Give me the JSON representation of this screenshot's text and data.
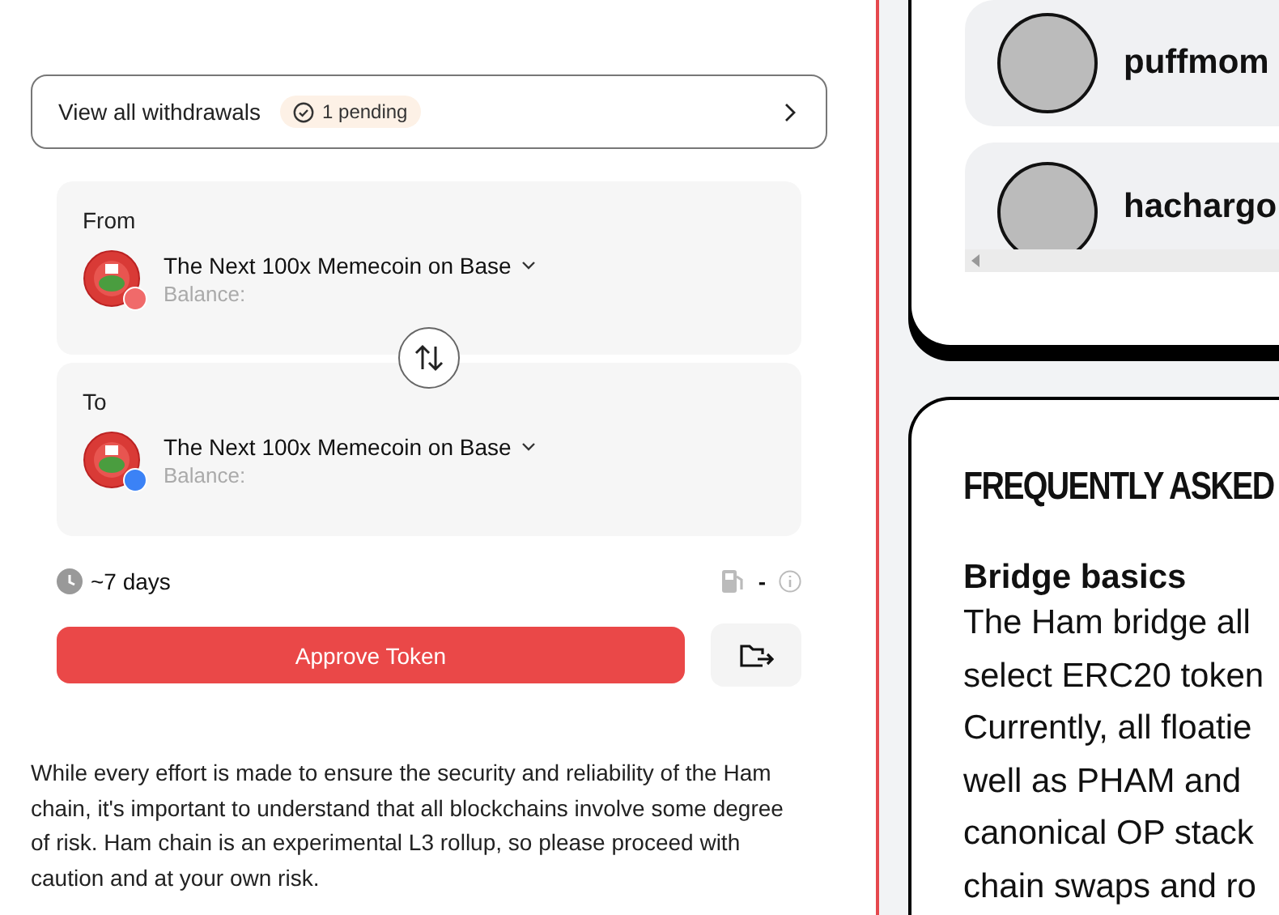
{
  "withdrawals": {
    "label": "View all withdrawals",
    "badge": "1 pending"
  },
  "bridge": {
    "from": {
      "heading": "From",
      "token": "The Next 100x Memecoin on Base",
      "balance_label": "Balance:"
    },
    "to": {
      "heading": "To",
      "token": "The Next 100x Memecoin on Base",
      "balance_label": "Balance:"
    },
    "time": "~7 days",
    "fee": "-",
    "approve_button": "Approve Token"
  },
  "disclaimer": "While every effort is made to ensure the security and reliability of the Ham chain, it's important to understand that all blockchains involve some degree of risk. Ham chain is an experimental L3 rollup, so please proceed with caution and at your own risk.",
  "users": [
    {
      "name": "puffmom"
    },
    {
      "name": "hachargo"
    }
  ],
  "faq": {
    "title": "FREQUENTLY ASKED",
    "section": "Bridge basics",
    "lines": [
      "The Ham bridge all",
      "select ERC20 token",
      "Currently, all floatie",
      "well as PHAM and",
      "canonical OP stack",
      "chain swaps and ro"
    ]
  }
}
